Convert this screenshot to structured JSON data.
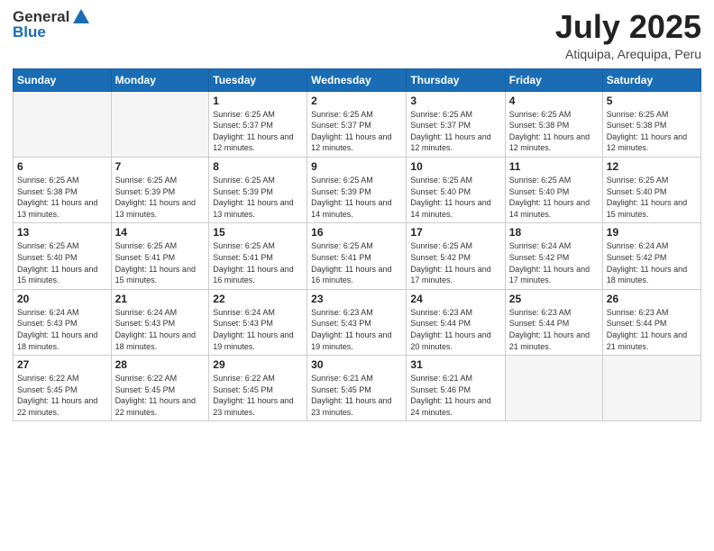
{
  "logo": {
    "general": "General",
    "blue": "Blue"
  },
  "title": "July 2025",
  "location": "Atiquipa, Arequipa, Peru",
  "days_of_week": [
    "Sunday",
    "Monday",
    "Tuesday",
    "Wednesday",
    "Thursday",
    "Friday",
    "Saturday"
  ],
  "weeks": [
    [
      {
        "day": "",
        "info": ""
      },
      {
        "day": "",
        "info": ""
      },
      {
        "day": "1",
        "info": "Sunrise: 6:25 AM\nSunset: 5:37 PM\nDaylight: 11 hours and 12 minutes."
      },
      {
        "day": "2",
        "info": "Sunrise: 6:25 AM\nSunset: 5:37 PM\nDaylight: 11 hours and 12 minutes."
      },
      {
        "day": "3",
        "info": "Sunrise: 6:25 AM\nSunset: 5:37 PM\nDaylight: 11 hours and 12 minutes."
      },
      {
        "day": "4",
        "info": "Sunrise: 6:25 AM\nSunset: 5:38 PM\nDaylight: 11 hours and 12 minutes."
      },
      {
        "day": "5",
        "info": "Sunrise: 6:25 AM\nSunset: 5:38 PM\nDaylight: 11 hours and 12 minutes."
      }
    ],
    [
      {
        "day": "6",
        "info": "Sunrise: 6:25 AM\nSunset: 5:38 PM\nDaylight: 11 hours and 13 minutes."
      },
      {
        "day": "7",
        "info": "Sunrise: 6:25 AM\nSunset: 5:39 PM\nDaylight: 11 hours and 13 minutes."
      },
      {
        "day": "8",
        "info": "Sunrise: 6:25 AM\nSunset: 5:39 PM\nDaylight: 11 hours and 13 minutes."
      },
      {
        "day": "9",
        "info": "Sunrise: 6:25 AM\nSunset: 5:39 PM\nDaylight: 11 hours and 14 minutes."
      },
      {
        "day": "10",
        "info": "Sunrise: 6:25 AM\nSunset: 5:40 PM\nDaylight: 11 hours and 14 minutes."
      },
      {
        "day": "11",
        "info": "Sunrise: 6:25 AM\nSunset: 5:40 PM\nDaylight: 11 hours and 14 minutes."
      },
      {
        "day": "12",
        "info": "Sunrise: 6:25 AM\nSunset: 5:40 PM\nDaylight: 11 hours and 15 minutes."
      }
    ],
    [
      {
        "day": "13",
        "info": "Sunrise: 6:25 AM\nSunset: 5:40 PM\nDaylight: 11 hours and 15 minutes."
      },
      {
        "day": "14",
        "info": "Sunrise: 6:25 AM\nSunset: 5:41 PM\nDaylight: 11 hours and 15 minutes."
      },
      {
        "day": "15",
        "info": "Sunrise: 6:25 AM\nSunset: 5:41 PM\nDaylight: 11 hours and 16 minutes."
      },
      {
        "day": "16",
        "info": "Sunrise: 6:25 AM\nSunset: 5:41 PM\nDaylight: 11 hours and 16 minutes."
      },
      {
        "day": "17",
        "info": "Sunrise: 6:25 AM\nSunset: 5:42 PM\nDaylight: 11 hours and 17 minutes."
      },
      {
        "day": "18",
        "info": "Sunrise: 6:24 AM\nSunset: 5:42 PM\nDaylight: 11 hours and 17 minutes."
      },
      {
        "day": "19",
        "info": "Sunrise: 6:24 AM\nSunset: 5:42 PM\nDaylight: 11 hours and 18 minutes."
      }
    ],
    [
      {
        "day": "20",
        "info": "Sunrise: 6:24 AM\nSunset: 5:43 PM\nDaylight: 11 hours and 18 minutes."
      },
      {
        "day": "21",
        "info": "Sunrise: 6:24 AM\nSunset: 5:43 PM\nDaylight: 11 hours and 18 minutes."
      },
      {
        "day": "22",
        "info": "Sunrise: 6:24 AM\nSunset: 5:43 PM\nDaylight: 11 hours and 19 minutes."
      },
      {
        "day": "23",
        "info": "Sunrise: 6:23 AM\nSunset: 5:43 PM\nDaylight: 11 hours and 19 minutes."
      },
      {
        "day": "24",
        "info": "Sunrise: 6:23 AM\nSunset: 5:44 PM\nDaylight: 11 hours and 20 minutes."
      },
      {
        "day": "25",
        "info": "Sunrise: 6:23 AM\nSunset: 5:44 PM\nDaylight: 11 hours and 21 minutes."
      },
      {
        "day": "26",
        "info": "Sunrise: 6:23 AM\nSunset: 5:44 PM\nDaylight: 11 hours and 21 minutes."
      }
    ],
    [
      {
        "day": "27",
        "info": "Sunrise: 6:22 AM\nSunset: 5:45 PM\nDaylight: 11 hours and 22 minutes."
      },
      {
        "day": "28",
        "info": "Sunrise: 6:22 AM\nSunset: 5:45 PM\nDaylight: 11 hours and 22 minutes."
      },
      {
        "day": "29",
        "info": "Sunrise: 6:22 AM\nSunset: 5:45 PM\nDaylight: 11 hours and 23 minutes."
      },
      {
        "day": "30",
        "info": "Sunrise: 6:21 AM\nSunset: 5:45 PM\nDaylight: 11 hours and 23 minutes."
      },
      {
        "day": "31",
        "info": "Sunrise: 6:21 AM\nSunset: 5:46 PM\nDaylight: 11 hours and 24 minutes."
      },
      {
        "day": "",
        "info": ""
      },
      {
        "day": "",
        "info": ""
      }
    ]
  ]
}
